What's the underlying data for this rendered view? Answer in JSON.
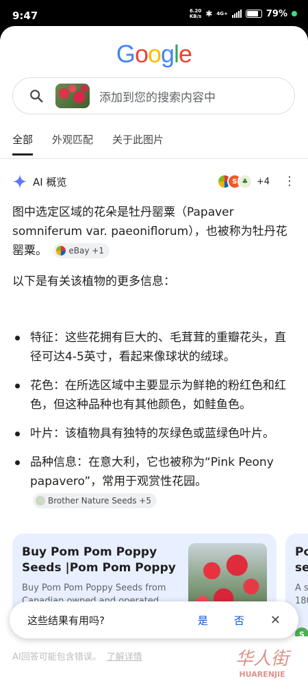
{
  "status_bar": {
    "time": "9:47",
    "net_speed_value": "6.20",
    "net_speed_unit": "KB/s",
    "signal_label": "4G+",
    "battery_percent": "79%",
    "battery_level": 0.79
  },
  "logo": {
    "text": "Google",
    "colors": [
      "#4285f4",
      "#ea4335",
      "#fbbc05",
      "#4285f4",
      "#34a853",
      "#ea4335"
    ]
  },
  "search": {
    "placeholder": "添加到您的搜索内容中",
    "icon": "search-icon"
  },
  "tabs": [
    {
      "label": "全部",
      "active": true
    },
    {
      "label": "外观匹配",
      "active": false
    },
    {
      "label": "关于此图片",
      "active": false
    }
  ],
  "ai_overview": {
    "title": "AI 概览",
    "sources_more": "+4",
    "intro": "图中选定区域的花朵是牡丹罂粟（Papaver somniferum var. paeoniflorum），也被称为牡丹花罂粟。",
    "intro_chip": "eBay +1",
    "more_info_heading": "以下是有关该植物的更多信息：",
    "bullets": [
      "特征：这些花拥有巨大的、毛茸茸的重瓣花头，直径可达4-5英寸，看起来像球状的绒球。",
      "花色：在所选区域中主要显示为鲜艳的粉红色和红色，但这种品种也有其他颜色，如鲑鱼色。",
      "叶片：该植物具有独特的灰绿色或蓝绿色叶片。",
      "品种信息：在意大利，它也被称为“Pink Peony papavero”，常用于观赏性花园。"
    ],
    "bullet4_chip": "Brother Nature Seeds +5"
  },
  "cards": [
    {
      "title": "Buy Pom Pom Poppy Seeds |Pom Pom Poppy Seeds…",
      "snippet": "Buy Pom Pom Poppy Seeds from Canadian owned and operated…"
    },
    {
      "title_partial_1": "Po",
      "title_partial_2": "se",
      "snippet_partial_1": "A s",
      "snippet_partial_2": "180",
      "source_icon_letter": "S"
    }
  ],
  "feedback": {
    "question": "这些结果有用吗?",
    "yes": "是",
    "no": "否"
  },
  "disclaimer": {
    "text": "AI回答可能包含错误。",
    "link": "了解详情"
  },
  "watermark": {
    "main": "华人街",
    "sub": "HUARENJIE"
  }
}
